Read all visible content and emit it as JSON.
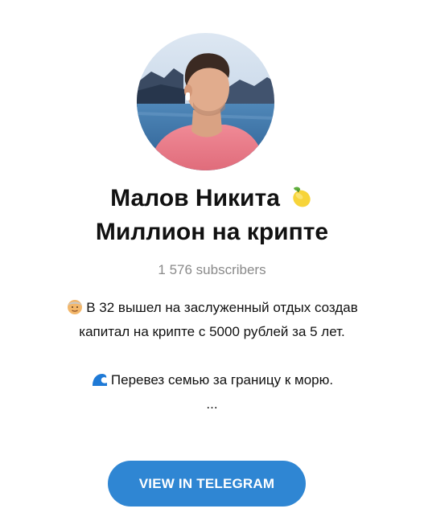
{
  "channel": {
    "title_line1": "Малов Никита",
    "title_line2": "Миллион на крипте",
    "title_emoji": "lemon-icon",
    "subscribers": "1 576 subscribers"
  },
  "description": {
    "line1_emoji": "older-man-icon",
    "line1": "В 32 вышел на заслуженный отдых создав",
    "line2": "капитал на крипте с 5000 рублей за 5 лет.",
    "line3_emoji": "wave-icon",
    "line3": "Перевез семью за границу к морю.",
    "line4": "..."
  },
  "button": {
    "label": "VIEW IN TELEGRAM",
    "color": "#2f86d3"
  }
}
